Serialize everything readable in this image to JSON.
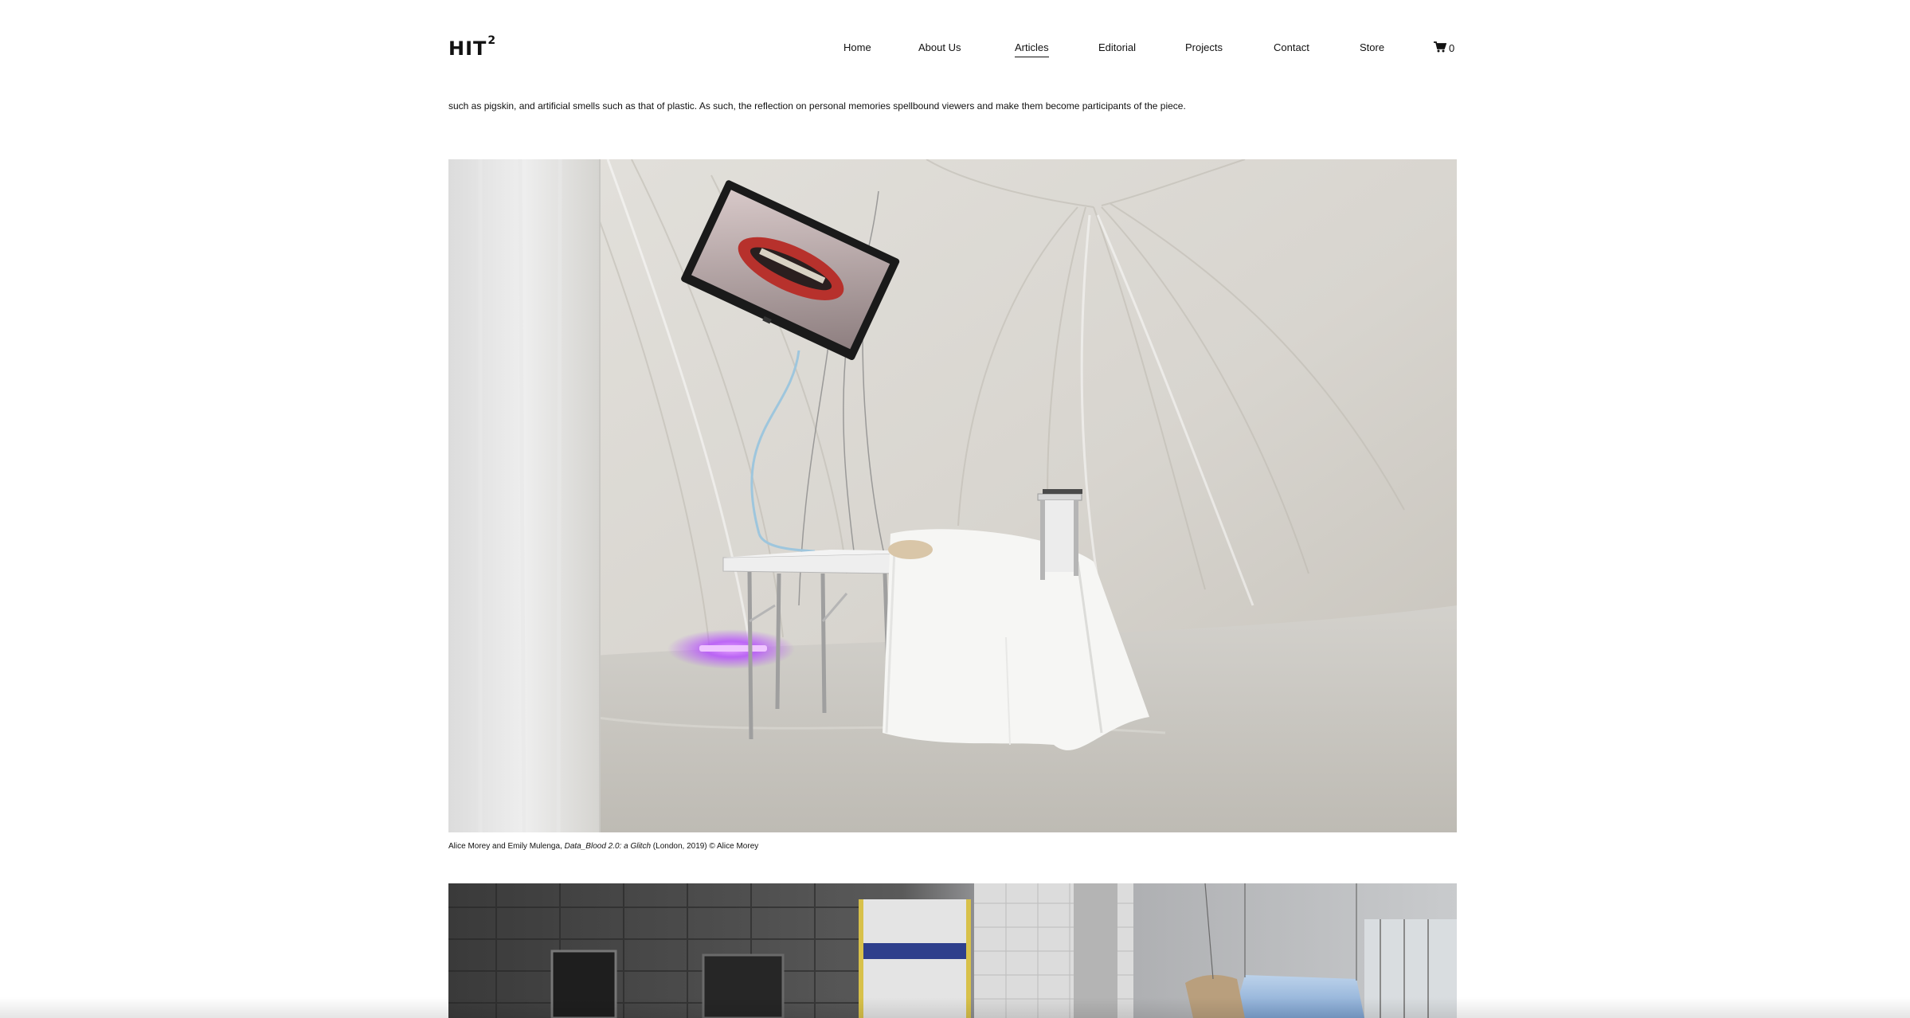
{
  "site": {
    "logo": "HIT",
    "logo_sup": "2"
  },
  "nav": {
    "items": [
      {
        "label": "Home"
      },
      {
        "label": "About Us"
      },
      {
        "label": "Articles",
        "active": true
      },
      {
        "label": "Editorial"
      },
      {
        "label": "Projects"
      },
      {
        "label": "Contact"
      },
      {
        "label": "Store"
      }
    ],
    "cart_count": "0",
    "cart_icon": "cart-icon"
  },
  "article": {
    "paragraph": "such as pigskin, and artificial smells such as that of plastic. As such, the reflection on personal memories spellbound viewers and make them become participants of the piece.",
    "figure1": {
      "caption_prefix": "Alice Morey and Emily Mulenga, ",
      "caption_title": "Data_Blood 2.0: a Glitch",
      "caption_suffix": " (London, 2019) © Alice Morey"
    }
  },
  "colors": {
    "text": "#111111",
    "background": "#ffffff",
    "drape": "#e6e3dc",
    "uv_light": "#c04cff",
    "lips": "#c0302c"
  }
}
